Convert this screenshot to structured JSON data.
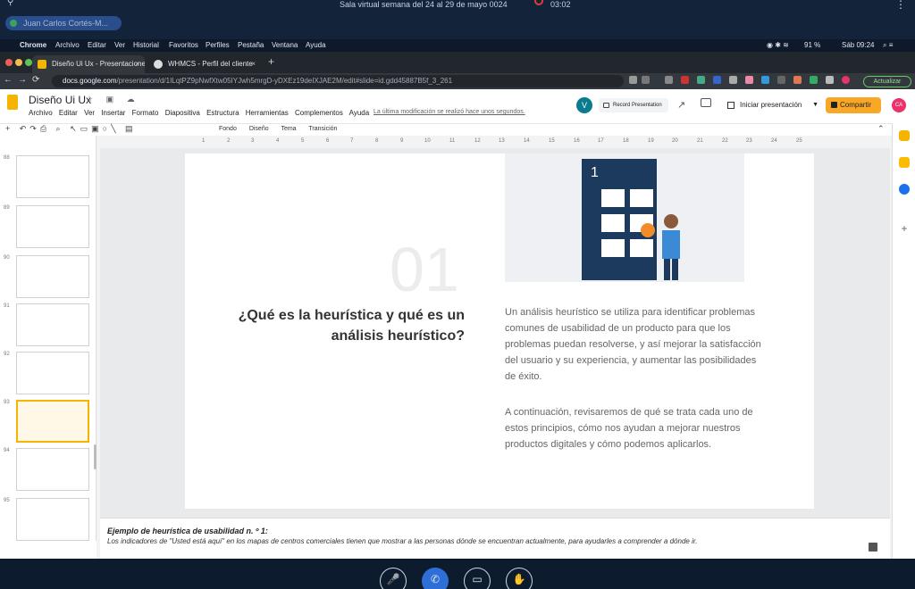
{
  "meeting": {
    "participant_name": "Juan Carlos Cortés-M...",
    "title": "Sala virtual semana del 24 al 29 de mayo 0024",
    "timer": "03:02"
  },
  "macos": {
    "app": "Chrome",
    "menu": [
      "Archivo",
      "Editar",
      "Ver",
      "Historial",
      "Favoritos",
      "Perfiles",
      "Pestaña",
      "Ventana",
      "Ayuda"
    ],
    "battery": "91 %",
    "clock": "Sáb 09:24"
  },
  "browser": {
    "tabs": [
      {
        "label": "Diseño Ui Ux - Presentaciones"
      },
      {
        "label": "WHMCS - Perfil del cliente"
      }
    ],
    "url_host": "docs.google.com",
    "url_path": "/presentation/d/1ILqtPZ9pNwfXtw05IYJwh5mrgD-yDXEz19deIXJAE2M/edit#slide=id.gdd45887B5f_3_261",
    "update_label": "Actualizar"
  },
  "slides": {
    "doc_title": "Diseño Ui Ux",
    "menus": [
      "Archivo",
      "Editar",
      "Ver",
      "Insertar",
      "Formato",
      "Diapositiva",
      "Estructura",
      "Herramientas",
      "Complementos",
      "Ayuda"
    ],
    "last_edit": "La última modificación se realizó hace unos segundos.",
    "record_label": "Record Presentation",
    "present_label": "Iniciar presentación",
    "share_label": "Compartir",
    "toolbar_text": [
      "Fondo",
      "Diseño",
      "Tema",
      "Transición"
    ],
    "thumb_numbers": [
      "88",
      "89",
      "90",
      "91",
      "92",
      "93",
      "94",
      "95"
    ],
    "ruler": [
      "1",
      "2",
      "3",
      "4",
      "5",
      "6",
      "7",
      "8",
      "9",
      "10",
      "11",
      "12",
      "13",
      "14",
      "15",
      "16",
      "17",
      "18",
      "19",
      "20",
      "21",
      "22",
      "23",
      "24",
      "25"
    ]
  },
  "slide": {
    "number": "01",
    "heading": "¿Qué es la heurística y qué es un análisis heurístico?",
    "para1": "Un análisis heurístico se utiliza para identificar problemas comunes de usabilidad de un producto para que los problemas puedan resolverse, y así mejorar la satisfacción del usuario y su experiencia, y aumentar las posibilidades de éxito.",
    "para2": "A continuación, revisaremos de qué se trata cada uno de estos principios, cómo nos ayudan a mejorar nuestros productos digitales y cómo podemos aplicarlos."
  },
  "notes": {
    "title": "Ejemplo de heurística de usabilidad n. º 1:",
    "body": "Los indicadores de \"Usted está aquí\" en los mapas de centros comerciales tienen que mostrar a las personas dónde se encuentran actualmente, para ayudarles a comprender a dónde ir."
  },
  "colors": {
    "share": "#f8a825",
    "profile": "#e8336b",
    "call": "#2d6fd6"
  }
}
